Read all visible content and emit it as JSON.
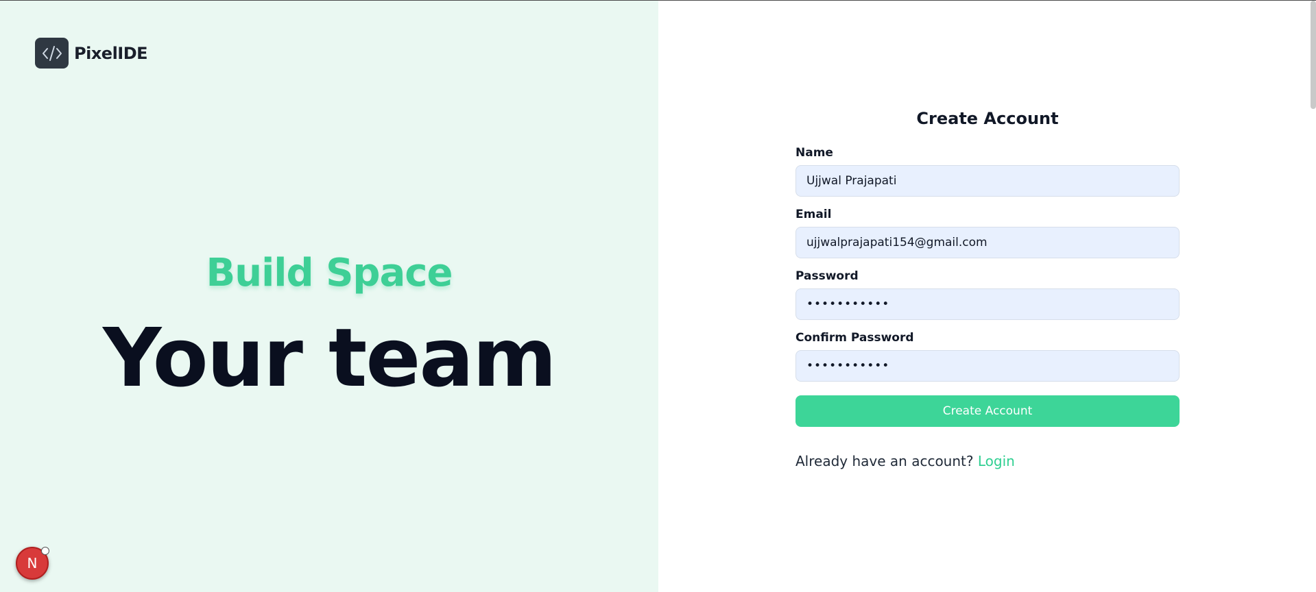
{
  "brand": {
    "name": "PixelIDE",
    "logo_icon": "code-brackets-icon"
  },
  "hero": {
    "subtitle": "Build Space",
    "headline": "Your team"
  },
  "dev_badge": {
    "letter": "N",
    "icon": "nextjs-icon"
  },
  "form": {
    "title": "Create Account",
    "fields": [
      {
        "label": "Name",
        "value": "Ujjwal Prajapati",
        "type": "text"
      },
      {
        "label": "Email",
        "value": "ujjwalprajapati154@gmail.com",
        "type": "email"
      },
      {
        "label": "Password",
        "value": "•••••••••••",
        "type": "password"
      },
      {
        "label": "Confirm Password",
        "value": "•••••••••••",
        "type": "password"
      }
    ],
    "submit_label": "Create Account",
    "login_prompt": "Already have an account?",
    "login_link": "Login"
  },
  "colors": {
    "accent": "#3dd598",
    "left_bg": "#eaf8f2",
    "headline": "#0a0f1f",
    "input_bg": "#e8f0fe"
  }
}
